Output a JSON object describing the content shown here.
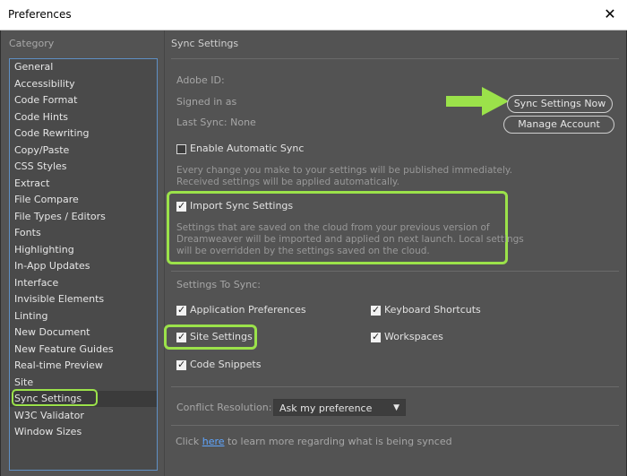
{
  "window": {
    "title": "Preferences",
    "close_glyph": "✕"
  },
  "sidebar": {
    "heading": "Category",
    "items": [
      "General",
      "Accessibility",
      "Code Format",
      "Code Hints",
      "Code Rewriting",
      "Copy/Paste",
      "CSS Styles",
      "Extract",
      "File Compare",
      "File Types / Editors",
      "Fonts",
      "Highlighting",
      "In-App Updates",
      "Interface",
      "Invisible Elements",
      "Linting",
      "New Document",
      "New Feature Guides",
      "Real-time Preview",
      "Site",
      "Sync Settings",
      "W3C Validator",
      "Window Sizes"
    ],
    "selected": "Sync Settings"
  },
  "pane": {
    "title": "Sync Settings",
    "adobe_id_label": "Adobe ID:",
    "signed_in_label": "Signed in as",
    "last_sync_label": "Last Sync: None",
    "sync_now_button": "Sync Settings Now",
    "manage_account_button": "Manage Account",
    "enable_auto_sync": {
      "label": "Enable Automatic Sync",
      "checked": false
    },
    "auto_sync_desc_1": "Every change you make to your settings will be published immediately.",
    "auto_sync_desc_2": "Received settings will be applied automatically.",
    "import_sync": {
      "label": "Import Sync Settings",
      "checked": true
    },
    "import_desc_1": "Settings that are saved on the cloud from your previous version of",
    "import_desc_2": "Dreamweaver will be imported and applied on next launch. Local settings",
    "import_desc_3": "will be overridden by the settings saved on the cloud.",
    "settings_to_sync_label": "Settings To Sync:",
    "sync_options": {
      "app_prefs": {
        "label": "Application Preferences",
        "checked": true
      },
      "keyboard": {
        "label": "Keyboard Shortcuts",
        "checked": true
      },
      "site_settings": {
        "label": "Site Settings",
        "checked": true
      },
      "workspaces": {
        "label": "Workspaces",
        "checked": true
      },
      "code_snippets": {
        "label": "Code Snippets",
        "checked": true
      }
    },
    "conflict_label": "Conflict Resolution:",
    "conflict_value": "Ask my preference",
    "footer_before": "Click ",
    "footer_link": "here",
    "footer_after": " to learn more regarding what is being synced"
  },
  "colors": {
    "highlight": "#9be24a",
    "link": "#5fa6ff",
    "bg": "#535353"
  },
  "icons": {
    "close": "close-icon",
    "check": "checkmark-icon",
    "dropdown": "chevron-down-icon",
    "arrow": "arrow-right-icon"
  }
}
